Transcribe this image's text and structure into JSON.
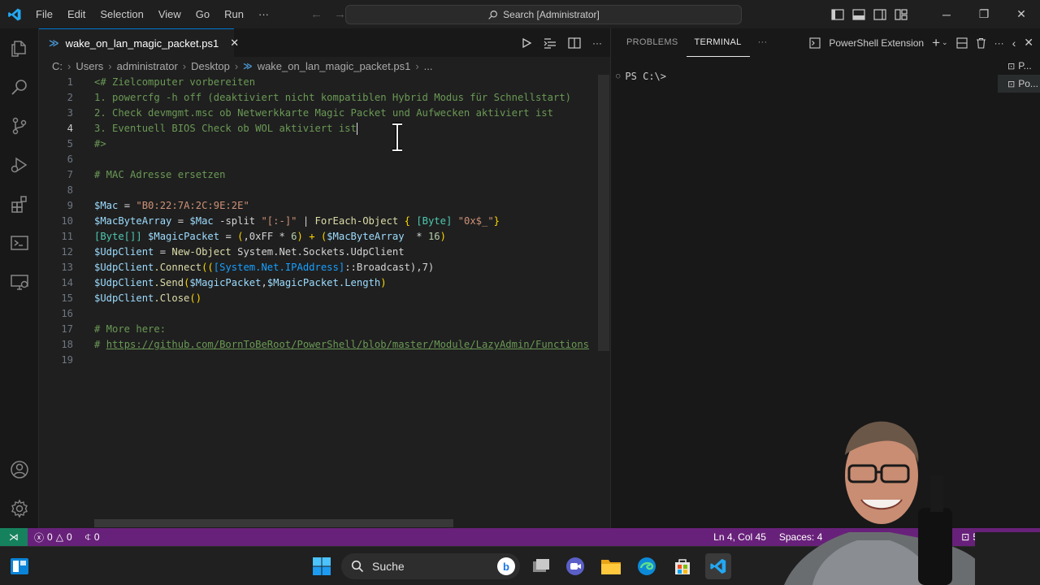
{
  "window": {
    "menu": [
      "File",
      "Edit",
      "Selection",
      "View",
      "Go",
      "Run"
    ],
    "menu_more": "···",
    "search_text": "Search [Administrator]"
  },
  "tab": {
    "filename": "wake_on_lan_magic_packet.ps1"
  },
  "breadcrumb": {
    "items": [
      "C:",
      "Users",
      "administrator",
      "Desktop",
      "wake_on_lan_magic_packet.ps1",
      "..."
    ]
  },
  "code": {
    "current_line": 4,
    "lines": [
      {
        "n": "1"
      },
      {
        "n": "2"
      },
      {
        "n": "3"
      },
      {
        "n": "4"
      },
      {
        "n": "5"
      },
      {
        "n": "6"
      },
      {
        "n": "7"
      },
      {
        "n": "8"
      },
      {
        "n": "9"
      },
      {
        "n": "10"
      },
      {
        "n": "11"
      },
      {
        "n": "12"
      },
      {
        "n": "13"
      },
      {
        "n": "14"
      },
      {
        "n": "15"
      },
      {
        "n": "16"
      },
      {
        "n": "17"
      },
      {
        "n": "18"
      },
      {
        "n": "19"
      }
    ],
    "t1": "<# Zielcomputer vorbereiten",
    "t2": "1. powercfg -h off (deaktiviert nicht kompatiblen Hybrid Modus für Schnellstart)",
    "t3": "2. Check devmgmt.msc ob Netwerkkarte Magic Packet und Aufwecken aktiviert ist",
    "t4": "3. Eventuell BIOS Check ob WOL aktiviert ist",
    "t5": "#>",
    "t7": "# MAC Adresse ersetzen",
    "t9a": "$Mac",
    "t9b": " = ",
    "t9c": "\"B0:22:7A:2C:9E:2E\"",
    "t10a": "$MacByteArray",
    "t10b": " = ",
    "t10c": "$Mac",
    "t10d": " -split ",
    "t10e": "\"[:-]\"",
    "t10f": " | ",
    "t10g": "ForEach-Object",
    "t10h": " { ",
    "t10i": "[Byte]",
    "t10j": " ",
    "t10k": "\"0x$_\"",
    "t10l": "}",
    "t11a": "[Byte[]]",
    "t11b": " ",
    "t11c": "$MagicPacket",
    "t11d": " = ",
    "t11e": "(",
    "t11f": ",0xFF",
    "t11g": " * ",
    "t11h": "6",
    "t11i": ") + (",
    "t11j": "$MacByteArray",
    "t11k": "  * ",
    "t11l": "16",
    "t11m": ")",
    "t12a": "$UdpClient",
    "t12b": " = ",
    "t12c": "New-Object",
    "t12d": " System.Net.Sockets.UdpClient",
    "t13a": "$UdpClient",
    "t13b": ".Connect",
    "t13c": "((",
    "t13d": "[System.Net.IPAddress]",
    "t13e": "::Broadcast),7)",
    "t14a": "$UdpClient",
    "t14b": ".Send",
    "t14c": "(",
    "t14d": "$MagicPacket",
    "t14e": ",",
    "t14f": "$MagicPacket",
    "t14g": ".Length",
    "t14h": ")",
    "t15a": "$UdpClient",
    "t15b": ".Close",
    "t15c": "()",
    "t17": "# More here:",
    "t18a": "# ",
    "t18b": "https://github.com/BornToBeRoot/PowerShell/blob/master/Module/LazyAdmin/Functions"
  },
  "panel": {
    "tabs": [
      "PROBLEMS",
      "TERMINAL"
    ],
    "more": "···",
    "terminal_name": "PowerShell Extension",
    "prompt": "PS C:\\>",
    "term_list": [
      "P...",
      "Po..."
    ]
  },
  "statusbar": {
    "errors": "0",
    "warnings": "0",
    "ports": "0",
    "position": "Ln 4, Col 45",
    "spaces": "Spaces: 4",
    "ps_version": "5.1"
  },
  "taskbar": {
    "search_label": "Suche"
  },
  "colors": {
    "statusbar": "#68217a",
    "remote": "#16825d",
    "accent": "#0078d4"
  }
}
